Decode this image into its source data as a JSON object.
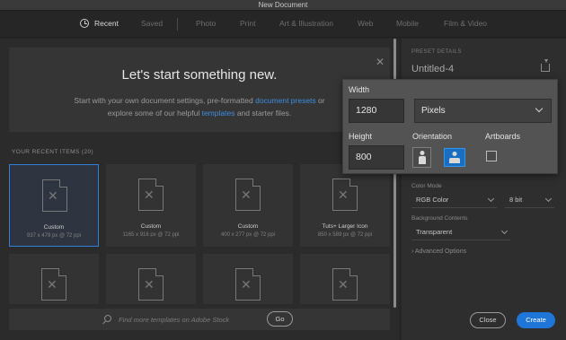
{
  "window": {
    "title": "New Document"
  },
  "tabs": [
    "Recent",
    "Saved",
    "Photo",
    "Print",
    "Art & Illustration",
    "Web",
    "Mobile",
    "Film & Video"
  ],
  "active_tab": "Recent",
  "welcome": {
    "title": "Let's start something new.",
    "line1_pre": "Start with your own document settings, pre-formatted ",
    "line1_link": "document presets",
    "line1_post": " or",
    "line2_pre": "explore some of our helpful ",
    "line2_link": "templates",
    "line2_post": " and starter files.",
    "close_glyph": "✕"
  },
  "recent": {
    "label": "YOUR RECENT ITEMS",
    "count": "(20)",
    "items": [
      {
        "name": "Custom",
        "dims": "937 x 479 px @ 72 ppi"
      },
      {
        "name": "Custom",
        "dims": "1165 x 916 px @ 72 ppi"
      },
      {
        "name": "Custom",
        "dims": "400 x 277 px @ 72 ppi"
      },
      {
        "name": "Tuts+ Larger Icon",
        "dims": "850 x 589 px @ 72 ppi"
      }
    ],
    "selected_index": 0
  },
  "search": {
    "placeholder": "Find more templates on Adobe Stock",
    "go_label": "Go"
  },
  "preset": {
    "section_label": "PRESET DETAILS",
    "name": "Untitled-4",
    "color_mode_label": "Color Mode",
    "color_mode": "RGB Color",
    "bit_depth": "8 bit",
    "background_label": "Background Contents",
    "background": "Transparent",
    "advanced": "› Advanced Options",
    "close_label": "Close",
    "create_label": "Create"
  },
  "popup": {
    "width_label": "Width",
    "width_value": "1280",
    "unit": "Pixels",
    "height_label": "Height",
    "height_value": "800",
    "orientation_label": "Orientation",
    "orientation": "landscape",
    "artboards_label": "Artboards",
    "artboards_checked": false
  },
  "colors": {
    "accent": "#1f76d8",
    "link": "#3e8de0",
    "background": "#262626",
    "popup": "#535353"
  }
}
